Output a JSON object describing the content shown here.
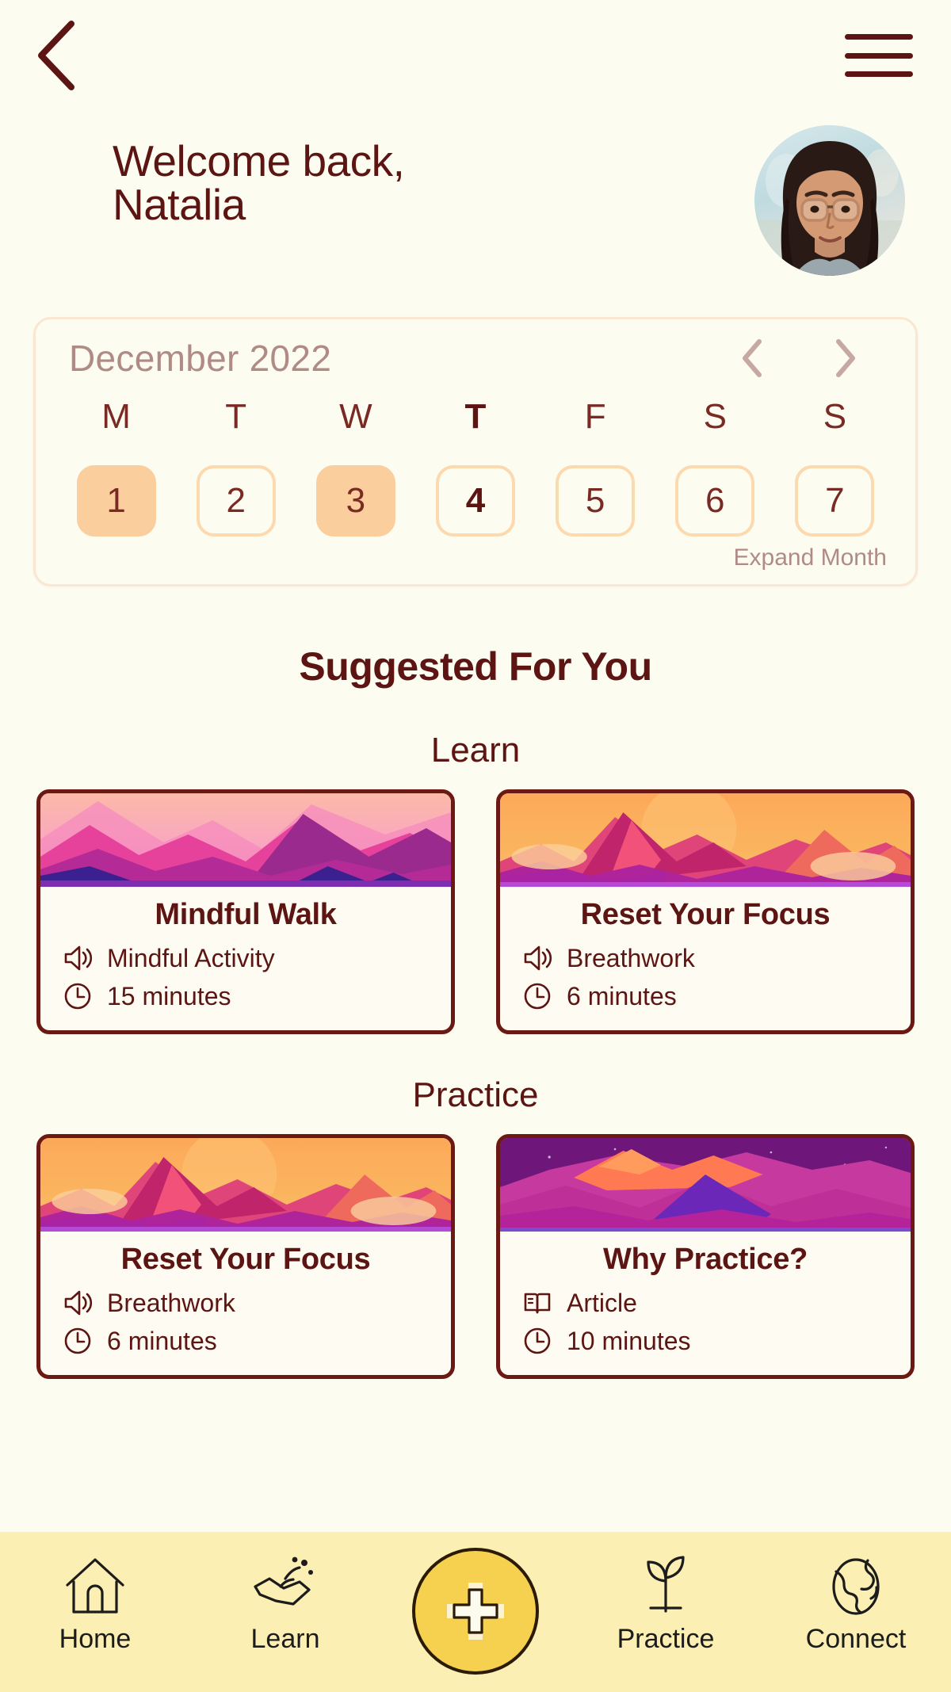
{
  "theme": {
    "bg": "#FDFCF0",
    "ink": "#5C1512",
    "muted": "#B08B86",
    "pill_fill": "#FBCE9D",
    "pill_outline": "#FCD9AF",
    "nav_bg": "#FBEFB3",
    "fab": "#F5D14F",
    "card_border": "#6B1A13"
  },
  "topbar": {
    "back_icon": "chevron-left-icon",
    "menu_icon": "hamburger-menu-icon"
  },
  "header": {
    "greeting": "Welcome back,\nNatalia",
    "avatar_alt": "avatar"
  },
  "calendar": {
    "month_label": "December 2022",
    "prev_icon": "chevron-left-icon",
    "next_icon": "chevron-right-icon",
    "expand_label": "Expand Month",
    "weekdays": [
      "M",
      "T",
      "W",
      "T",
      "F",
      "S",
      "S"
    ],
    "today_index": 3,
    "days": [
      {
        "num": "1",
        "state": "filled"
      },
      {
        "num": "2",
        "state": "outline"
      },
      {
        "num": "3",
        "state": "filled"
      },
      {
        "num": "4",
        "state": "outline"
      },
      {
        "num": "5",
        "state": "outline"
      },
      {
        "num": "6",
        "state": "outline"
      },
      {
        "num": "7",
        "state": "outline"
      }
    ]
  },
  "main": {
    "suggested_title": "Suggested For You",
    "sections": [
      {
        "heading": "Learn",
        "cards": [
          {
            "title": "Mindful Walk",
            "type_label": "Mindful Activity",
            "type_icon": "speaker-icon",
            "duration_label": "15 minutes",
            "duration_icon": "clock-icon",
            "art": "pink-mountains"
          },
          {
            "title": "Reset Your Focus",
            "type_label": "Breathwork",
            "type_icon": "speaker-icon",
            "duration_label": "6 minutes",
            "duration_icon": "clock-icon",
            "art": "orange-mountains"
          }
        ]
      },
      {
        "heading": "Practice",
        "cards": [
          {
            "title": "Reset Your Focus",
            "type_label": "Breathwork",
            "type_icon": "speaker-icon",
            "duration_label": "6 minutes",
            "duration_icon": "clock-icon",
            "art": "orange-mountains"
          },
          {
            "title": "Why Practice?",
            "type_label": "Article",
            "type_icon": "book-icon",
            "duration_label": "10 minutes",
            "duration_icon": "clock-icon",
            "art": "purple-mountains"
          }
        ]
      }
    ]
  },
  "bottomnav": {
    "items": [
      {
        "label": "Home",
        "icon": "house-icon"
      },
      {
        "label": "Learn",
        "icon": "hand-seedling-icon"
      },
      {
        "label": "",
        "icon": "plus-icon"
      },
      {
        "label": "Practice",
        "icon": "sprout-icon"
      },
      {
        "label": "Connect",
        "icon": "globe-icon"
      }
    ]
  }
}
